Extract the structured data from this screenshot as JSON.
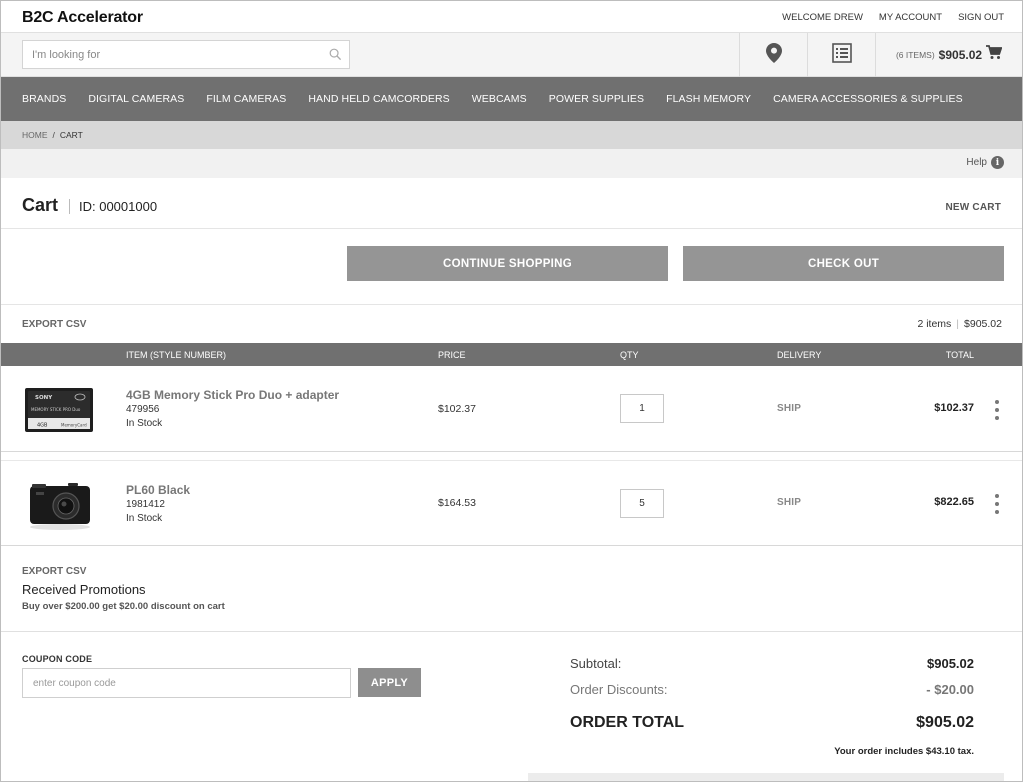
{
  "header": {
    "brand": "B2C Accelerator",
    "welcome": "WELCOME DREW",
    "my_account": "MY ACCOUNT",
    "sign_out": "SIGN OUT"
  },
  "search": {
    "placeholder": "I'm looking for"
  },
  "mini_cart": {
    "items": "(6 ITEMS)",
    "amount": "$905.02"
  },
  "nav": {
    "items": [
      "BRANDS",
      "DIGITAL CAMERAS",
      "FILM CAMERAS",
      "HAND HELD CAMCORDERS",
      "WEBCAMS",
      "POWER SUPPLIES",
      "FLASH MEMORY",
      "CAMERA ACCESSORIES & SUPPLIES"
    ]
  },
  "breadcrumb": {
    "home": "HOME",
    "separator": "/",
    "current": "CART"
  },
  "help": {
    "label": "Help",
    "icon_glyph": "i"
  },
  "cart": {
    "title": "Cart",
    "id_label": "ID: 00001000",
    "new_cart": "NEW CART",
    "continue_shopping": "CONTINUE SHOPPING",
    "check_out": "CHECK OUT",
    "export_csv": "EXPORT CSV",
    "summary_items": "2 items",
    "summary_sep": "|",
    "summary_total": "$905.02"
  },
  "table": {
    "headers": {
      "item": "ITEM (STYLE NUMBER)",
      "price": "PRICE",
      "qty": "QTY",
      "delivery": "DELIVERY",
      "total": "TOTAL"
    },
    "rows": [
      {
        "name": "4GB Memory Stick Pro Duo + adapter",
        "number": "479956",
        "stock": "In Stock",
        "price": "$102.37",
        "qty": "1",
        "delivery": "SHIP",
        "total": "$102.37"
      },
      {
        "name": "PL60 Black",
        "number": "1981412",
        "stock": "In Stock",
        "price": "$164.53",
        "qty": "5",
        "delivery": "SHIP",
        "total": "$822.65"
      }
    ]
  },
  "thumb_text": {
    "brand": "SONY",
    "product": "MEMORY STICK PRO Duo",
    "capacity": "4GB",
    "tag": "MemoryCard"
  },
  "promotions": {
    "export_csv": "EXPORT CSV",
    "title": "Received Promotions",
    "description": "Buy over $200.00 get $20.00 discount on cart"
  },
  "coupon": {
    "label": "COUPON CODE",
    "placeholder": "enter coupon code",
    "apply": "APPLY"
  },
  "totals": {
    "subtotal_label": "Subtotal:",
    "subtotal": "$905.02",
    "discount_label": "Order Discounts:",
    "discount": "- $20.00",
    "grand_label": "ORDER TOTAL",
    "grand_total": "$905.02",
    "tax_note": "Your order includes $43.10 tax."
  },
  "colors": {
    "nav_bg": "#707070",
    "button_bg": "#959595",
    "breadcrumb_bg": "#d8d8d8"
  }
}
